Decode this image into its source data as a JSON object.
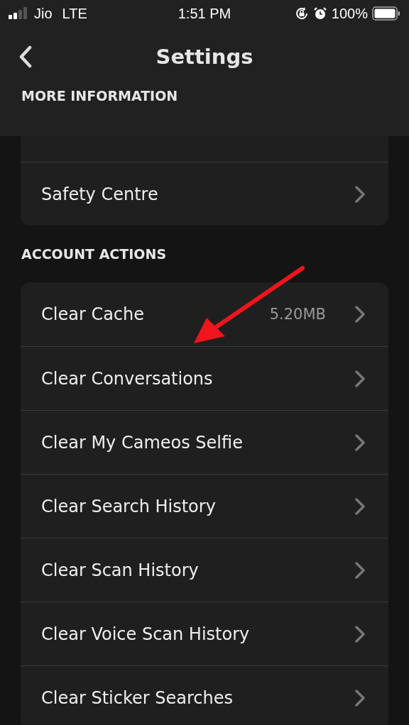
{
  "status_bar": {
    "carrier": "Jio",
    "network": "LTE",
    "time": "1:51 PM",
    "battery": "100%"
  },
  "header": {
    "title": "Settings"
  },
  "sections": [
    {
      "title": "MORE INFORMATION",
      "items": [
        {
          "label": "Safety Centre"
        }
      ]
    },
    {
      "title": "ACCOUNT ACTIONS",
      "items": [
        {
          "label": "Clear Cache",
          "value": "5.20MB"
        },
        {
          "label": "Clear Conversations"
        },
        {
          "label": "Clear My Cameos Selfie"
        },
        {
          "label": "Clear Search History"
        },
        {
          "label": "Clear Scan History"
        },
        {
          "label": "Clear Voice Scan History"
        },
        {
          "label": "Clear Sticker Searches"
        }
      ]
    }
  ]
}
